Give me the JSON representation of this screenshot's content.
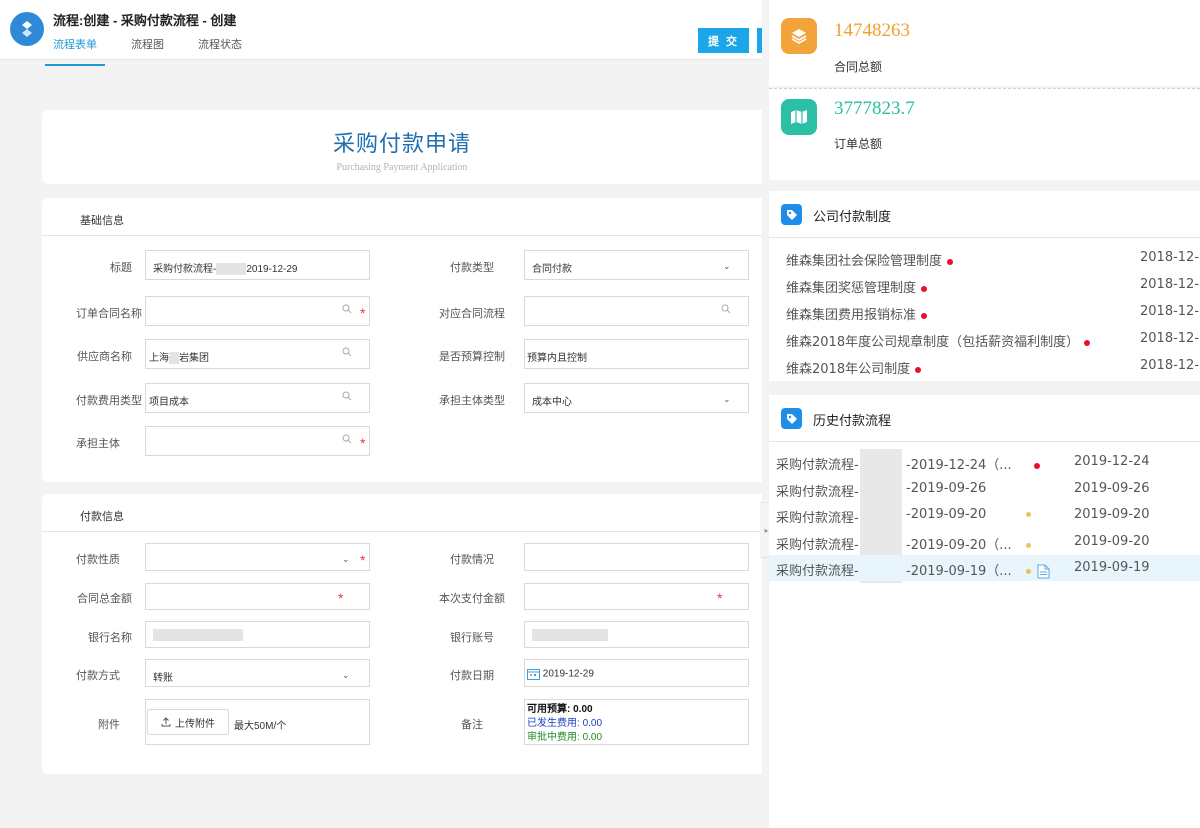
{
  "header": {
    "title": "流程:创建 - 采购付款流程 - 创建",
    "tabs": [
      "流程表单",
      "流程图",
      "流程状态"
    ],
    "submit_label": "提 交"
  },
  "form": {
    "title": "采购付款申请",
    "subtitle": "Purchasing Payment Application",
    "basic": {
      "section_title": "基础信息",
      "title_label": "标题",
      "title_prefix": "采购付款流程-",
      "title_suffix": "2019-12-29",
      "pay_type_label": "付款类型",
      "pay_type_value": "合同付款",
      "order_contract_label": "订单合同名称",
      "related_flow_label": "对应合同流程",
      "supplier_label": "供应商名称",
      "supplier_prefix": "上海",
      "supplier_suffix": "岩集团",
      "budget_control_label": "是否预算控制",
      "budget_control_value": "预算内且控制",
      "fee_type_label": "付款费用类型",
      "fee_type_value": "项目成本",
      "bearer_type_label": "承担主体类型",
      "bearer_type_value": "成本中心",
      "bearer_label": "承担主体"
    },
    "payment": {
      "section_title": "付款信息",
      "nature_label": "付款性质",
      "status_label": "付款情况",
      "contract_total_label": "合同总金额",
      "this_payment_label": "本次支付金额",
      "bank_name_label": "银行名称",
      "bank_account_label": "银行账号",
      "method_label": "付款方式",
      "method_value": "转账",
      "date_label": "付款日期",
      "date_value": "2019-12-29",
      "attachment_label": "附件",
      "upload_label": "上传附件",
      "upload_note": "最大50M/个",
      "remark_label": "备注",
      "remark_lines": [
        {
          "label": "可用预算:",
          "value": "0.00"
        },
        {
          "label": "已发生费用:",
          "value": "0.00"
        },
        {
          "label": "审批中费用:",
          "value": "0.00"
        }
      ]
    }
  },
  "sidebar": {
    "stats": [
      {
        "value": "14748263",
        "label": "合同总额",
        "color": "#f0a030"
      },
      {
        "value": "3777823.7",
        "label": "订单总额",
        "color": "#2bbfa5"
      }
    ],
    "policy": {
      "title": "公司付款制度",
      "items": [
        {
          "name": "维森集团社会保险管理制度",
          "date": "2018-12-"
        },
        {
          "name": "维森集团奖惩管理制度",
          "date": "2018-12-"
        },
        {
          "name": "维森集团费用报销标准",
          "date": "2018-12-"
        },
        {
          "name": "维森2018年度公司规章制度（包括薪资福利制度）",
          "date": "2018-12-"
        },
        {
          "name": "维森2018年公司制度",
          "date": "2018-12-"
        }
      ]
    },
    "history": {
      "title": "历史付款流程",
      "items": [
        {
          "prefix": "采购付款流程-",
          "suffix": "-2019-12-24（...",
          "date": "2019-12-24",
          "dot": "red"
        },
        {
          "prefix": "采购付款流程-",
          "suffix": "-2019-09-26",
          "date": "2019-09-26",
          "dot": ""
        },
        {
          "prefix": "采购付款流程-",
          "suffix": "-2019-09-20",
          "date": "2019-09-20",
          "dot": "yellow"
        },
        {
          "prefix": "采购付款流程-",
          "suffix": "-2019-09-20（...",
          "date": "2019-09-20",
          "dot": "yellow"
        },
        {
          "prefix": "采购付款流程-",
          "suffix": "-2019-09-19（...",
          "date": "2019-09-19",
          "dot": "yellow"
        }
      ]
    }
  }
}
